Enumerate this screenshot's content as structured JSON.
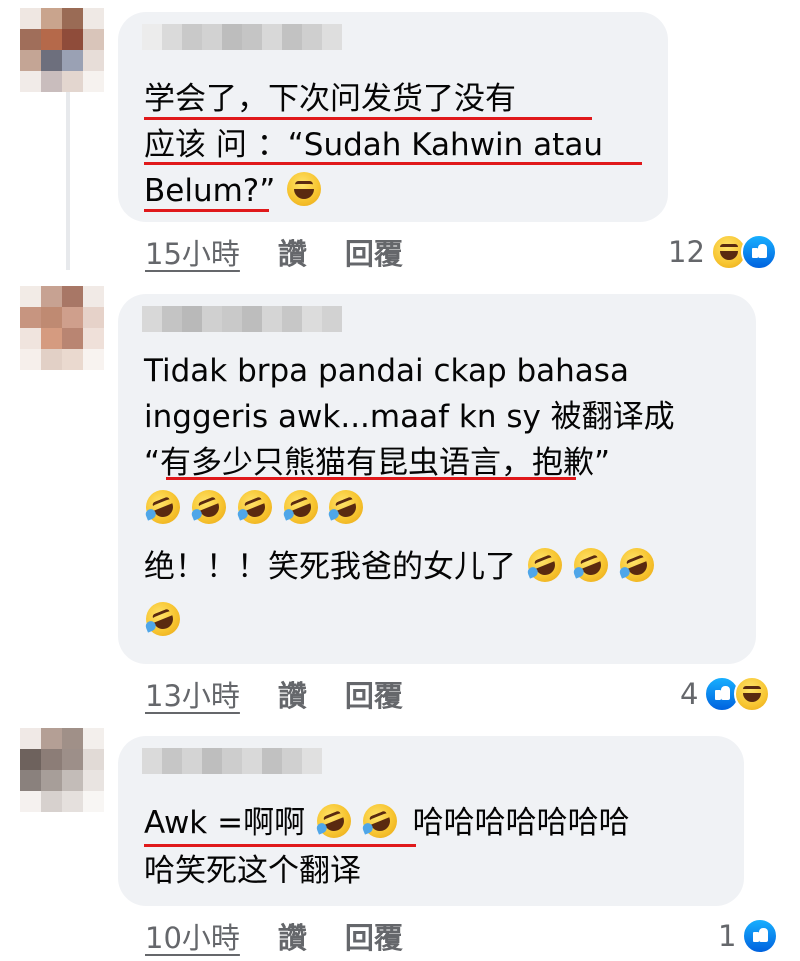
{
  "comments": [
    {
      "lines": [
        "学会了，下次问发货了没有",
        "应该 问 ：“Sudah Kahwin atau",
        "Belum?”"
      ],
      "time": "15小時",
      "like_label": "讚",
      "reply_label": "回覆",
      "reaction_count": "12",
      "reactions": [
        "haha-icon",
        "like-icon"
      ]
    },
    {
      "lines": [
        "Tidak brpa pandai ckap bahasa",
        "inggeris awk...maaf kn sy 被翻译成",
        "“有多少只熊猫有昆虫语言，抱歉”",
        "",
        "绝！！！笑死我爸的女儿了",
        ""
      ],
      "time": "13小時",
      "like_label": "讚",
      "reply_label": "回覆",
      "reaction_count": "4",
      "reactions": [
        "like-icon",
        "haha-icon"
      ]
    },
    {
      "lines": [
        "Awk =啊啊",
        "哈哈哈哈哈哈哈",
        "哈笑死这个翻译"
      ],
      "time": "10小時",
      "like_label": "讚",
      "reply_label": "回覆",
      "reaction_count": "1",
      "reactions": [
        "like-icon"
      ]
    }
  ],
  "colors": {
    "bubble": "#f0f2f5",
    "underline": "#e0191b",
    "meta_text": "#65676b",
    "like_blue": "#0862f2"
  }
}
